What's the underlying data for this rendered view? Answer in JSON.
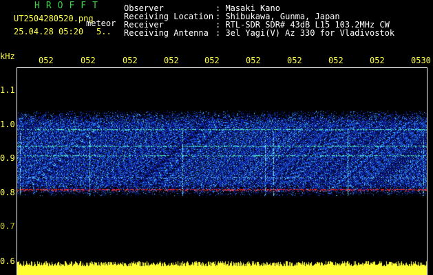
{
  "header": {
    "title": "HROFFT",
    "filename": "UT2504280520.png",
    "mode": "meteor",
    "datetime": "25.04.28 05:20",
    "extra": "5.."
  },
  "info": {
    "labels": [
      "Observer",
      "Receiving Location",
      "Receiver",
      "Receiving Antenna"
    ],
    "values": [
      ": Masaki Kano",
      ": Shibukawa, Gunma, Japan",
      ": RTL-SDR SDR# 43dB L15 103.2MHz CW",
      ": 3el Yagi(V) Az 330 for Vladivostok"
    ]
  },
  "axes": {
    "unit": "kHz",
    "x_ticks": [
      "052",
      "052",
      "052",
      "052",
      "052",
      "052",
      "052",
      "052",
      "052",
      "0530"
    ],
    "y_ticks": [
      "1.1",
      "1.0",
      "0.9",
      "0.8",
      "0.7",
      "0.6"
    ]
  },
  "colors": {
    "background": "#000000",
    "title": "#3fd24a",
    "ticks": "#ffff4d",
    "signal_red": "#ff2a2a",
    "signal_cyan": "#5fffd0",
    "noise_blue": "#1f3cff",
    "level_bar": "#ffff33"
  }
}
